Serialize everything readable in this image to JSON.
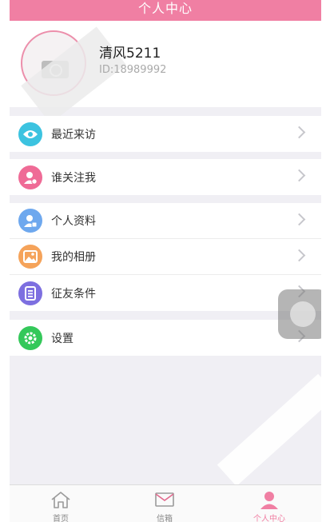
{
  "nav": {
    "title": "个人中心"
  },
  "profile": {
    "name": "清风5211",
    "id_text": "ID:18989992"
  },
  "menu": {
    "group1": [
      {
        "label": "最近来访",
        "icon": "eye-icon",
        "color": "#3cc3e0"
      }
    ],
    "group2": [
      {
        "label": "谁关注我",
        "icon": "follower-icon",
        "color": "#ef6b96"
      }
    ],
    "group3": [
      {
        "label": "个人资料",
        "icon": "profile-card-icon",
        "color": "#6ea8ee"
      },
      {
        "label": "我的相册",
        "icon": "album-icon",
        "color": "#f5a35a"
      },
      {
        "label": "征友条件",
        "icon": "list-icon",
        "color": "#7d6fe0"
      }
    ],
    "group4": [
      {
        "label": "设置",
        "icon": "gear-icon",
        "color": "#34c85a"
      }
    ]
  },
  "tabbar": [
    {
      "label": "首页",
      "icon": "home-icon",
      "active": false
    },
    {
      "label": "信箱",
      "icon": "mail-icon",
      "active": false
    },
    {
      "label": "个人中心",
      "icon": "user-icon",
      "active": true
    }
  ],
  "colors": {
    "accent": "#f07fa3",
    "background": "#f0eff4"
  }
}
